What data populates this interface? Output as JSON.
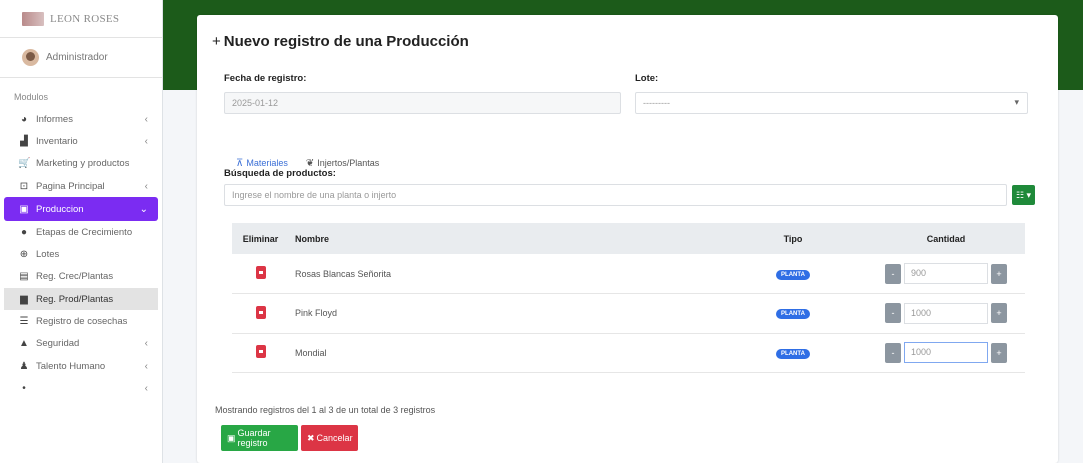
{
  "sidebar": {
    "brand": "LEON ROSES",
    "user": "Administrador",
    "section": "Modulos",
    "items": [
      {
        "icon": "chart-icon",
        "glyph": "◕",
        "label": "Informes",
        "chev": "‹"
      },
      {
        "icon": "boxes-icon",
        "glyph": "▟",
        "label": "Inventario",
        "chev": "‹"
      },
      {
        "icon": "cart-icon",
        "glyph": "🛒",
        "label": "Marketing y productos",
        "chev": ""
      },
      {
        "icon": "tag-icon",
        "glyph": "⊡",
        "label": "Pagina Principal",
        "chev": "‹"
      },
      {
        "icon": "calendar-icon",
        "glyph": "▣",
        "label": "Produccion",
        "chev": "⌄",
        "active": true
      },
      {
        "icon": "tint-icon",
        "glyph": "●",
        "label": "Etapas de Crecimiento",
        "chev": ""
      },
      {
        "icon": "link-icon",
        "glyph": "⊕",
        "label": "Lotes",
        "chev": ""
      },
      {
        "icon": "table-icon",
        "glyph": "▤",
        "label": "Reg. Crec/Plantas",
        "chev": ""
      },
      {
        "icon": "book-icon",
        "glyph": "▆",
        "label": "Reg. Prod/Plantas",
        "chev": "",
        "current": true
      },
      {
        "icon": "list-icon",
        "glyph": "☰",
        "label": "Registro de cosechas",
        "chev": ""
      },
      {
        "icon": "lock-icon",
        "glyph": "▲",
        "label": "Seguridad",
        "chev": "‹"
      },
      {
        "icon": "users-icon",
        "glyph": "♟",
        "label": "Talento Humano",
        "chev": "‹"
      },
      {
        "icon": "more-icon",
        "glyph": "•",
        "label": "",
        "chev": "‹"
      }
    ]
  },
  "page": {
    "title": "Nuevo registro de una Producción",
    "date_label": "Fecha de registro:",
    "date_value": "2025-01-12",
    "lote_label": "Lote:",
    "lote_value": "---------",
    "tabs": [
      "Materiales",
      "Injertos/Plantas"
    ],
    "search_label": "Búsqueda de productos:",
    "search_placeholder": "Ingrese el nombre de una planta o injerto",
    "table": {
      "headers": [
        "Eliminar",
        "Nombre",
        "Tipo",
        "Cantidad"
      ],
      "rows": [
        {
          "name": "Rosas Blancas Señorita",
          "type": "PLANTA",
          "qty": "900"
        },
        {
          "name": "Pink Floyd",
          "type": "PLANTA",
          "qty": "1000"
        },
        {
          "name": "Mondial",
          "type": "PLANTA",
          "qty": "1000"
        }
      ]
    },
    "footer": "Mostrando registros del 1 al 3 de un total de 3 registros",
    "save_label": "Guardar registro",
    "cancel_label": "Cancelar"
  },
  "colors": {
    "topband": "#1c5b1a",
    "active_nav": "#7b2cf2",
    "save": "#28a745",
    "cancel": "#dc3545",
    "badge": "#2f6ee5"
  }
}
